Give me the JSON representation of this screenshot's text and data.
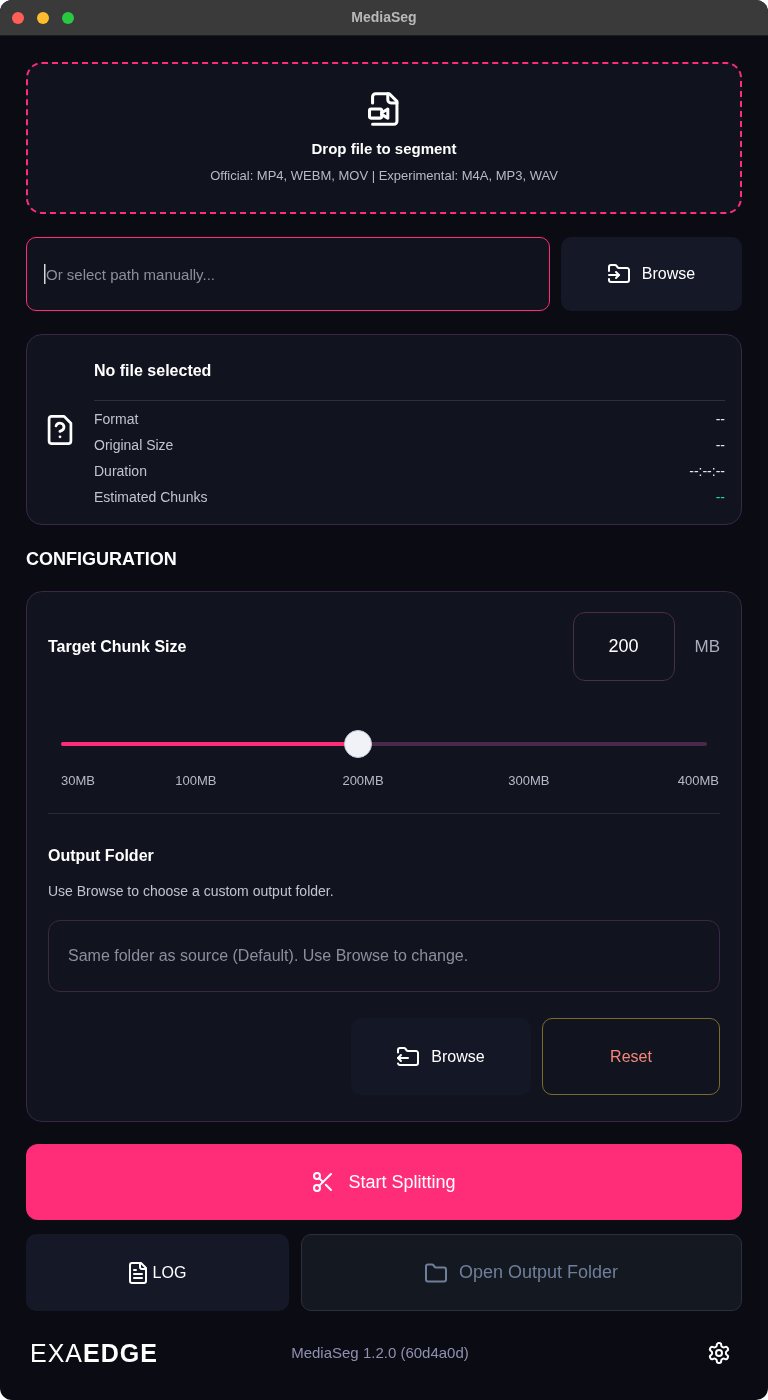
{
  "window": {
    "title": "MediaSeg"
  },
  "drop_zone": {
    "title": "Drop file to segment",
    "formats": "Official: MP4, WEBM, MOV | Experimental: M4A, MP3, WAV"
  },
  "path_input": {
    "placeholder": "Or select path manually...",
    "focused": true
  },
  "browse_button": {
    "label": "Browse"
  },
  "file_info": {
    "title": "No file selected",
    "rows": [
      {
        "label": "Format",
        "value": "--",
        "kind": "plain"
      },
      {
        "label": "Original Size",
        "value": "--",
        "kind": "plain"
      },
      {
        "label": "Duration",
        "value": "--:--:--",
        "kind": "plain"
      },
      {
        "label": "Estimated Chunks",
        "value": "--",
        "kind": "highlight"
      }
    ]
  },
  "configuration": {
    "heading": "CONFIGURATION",
    "chunk_size": {
      "label": "Target Chunk Size",
      "value": "200",
      "unit": "MB",
      "level": 0.46,
      "ticks": [
        "30MB",
        "100MB",
        "200MB",
        "300MB",
        "400MB"
      ]
    },
    "output_folder": {
      "label": "Output Folder",
      "hint": "Use Browse to choose a custom output folder.",
      "placeholder": "Same folder as source (Default). Use Browse to change.",
      "buttons": [
        {
          "label": "Browse",
          "kind": "browse"
        },
        {
          "label": "Reset",
          "kind": "reset"
        }
      ]
    }
  },
  "actions": {
    "start_button": {
      "label": "Start Splitting"
    },
    "secondary": [
      {
        "label": "LOG",
        "kind": "log",
        "disabled": false
      },
      {
        "label": "Open Output Folder",
        "kind": "folder",
        "disabled": true
      }
    ]
  },
  "footer": {
    "logo": "EXA**EDGE**",
    "version": "MediaSeg 1.2.0 (60d4a0d)"
  }
}
